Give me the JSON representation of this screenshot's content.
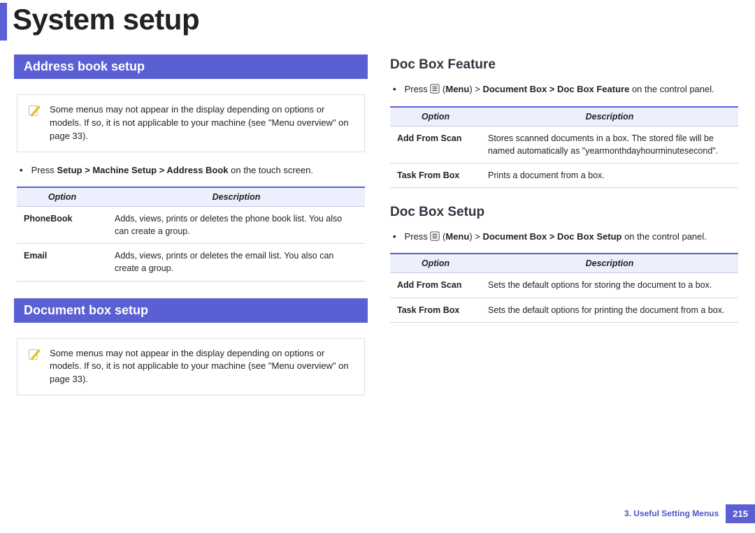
{
  "page_title": "System setup",
  "left": {
    "address_book_heading": "Address book setup",
    "note1": "Some menus may not appear in the display depending on options or models. If so, it is not applicable to your machine (see \"Menu overview\" on page 33).",
    "bullet1_pre": "Press ",
    "bullet1_bold": "Setup > Machine Setup > Address Book",
    "bullet1_post": " on the touch screen.",
    "table1": {
      "h_opt": "Option",
      "h_desc": "Description",
      "rows": [
        {
          "opt": "PhoneBook",
          "desc": "Adds, views, prints or deletes the phone book list. You also can create a group."
        },
        {
          "opt": "Email",
          "desc": "Adds, views, prints or deletes the email list. You also can create a group."
        }
      ]
    },
    "docbox_heading": "Document box setup",
    "note2": "Some menus may not appear in the display depending on options or models. If so, it is not applicable to your machine (see \"Menu overview\" on page 33)."
  },
  "right": {
    "feature_heading": "Doc Box Feature",
    "bullet_feature_pre": "Press ",
    "bullet_feature_menu": "Menu",
    "bullet_feature_path": "Document Box > Doc Box Feature",
    "bullet_feature_post": " on the control panel.",
    "table_feature": {
      "h_opt": "Option",
      "h_desc": "Description",
      "rows": [
        {
          "opt": "Add From Scan",
          "desc": "Stores scanned documents in a box. The stored file will be named automatically as \"yearmonthdayhourminutesecond\"."
        },
        {
          "opt": "Task From Box",
          "desc": "Prints a document from a box."
        }
      ]
    },
    "setup_heading": "Doc Box Setup",
    "bullet_setup_pre": "Press ",
    "bullet_setup_menu": "Menu",
    "bullet_setup_path": "Document Box > Doc Box Setup",
    "bullet_setup_post": " on the control panel.",
    "table_setup": {
      "h_opt": "Option",
      "h_desc": "Description",
      "rows": [
        {
          "opt": "Add From Scan",
          "desc": "Sets the default options for storing the document to a box."
        },
        {
          "opt": "Task From Box",
          "desc": "Sets the default options for printing the document from a box."
        }
      ]
    }
  },
  "footer": {
    "chapter": "3.  Useful Setting Menus",
    "page": "215"
  }
}
